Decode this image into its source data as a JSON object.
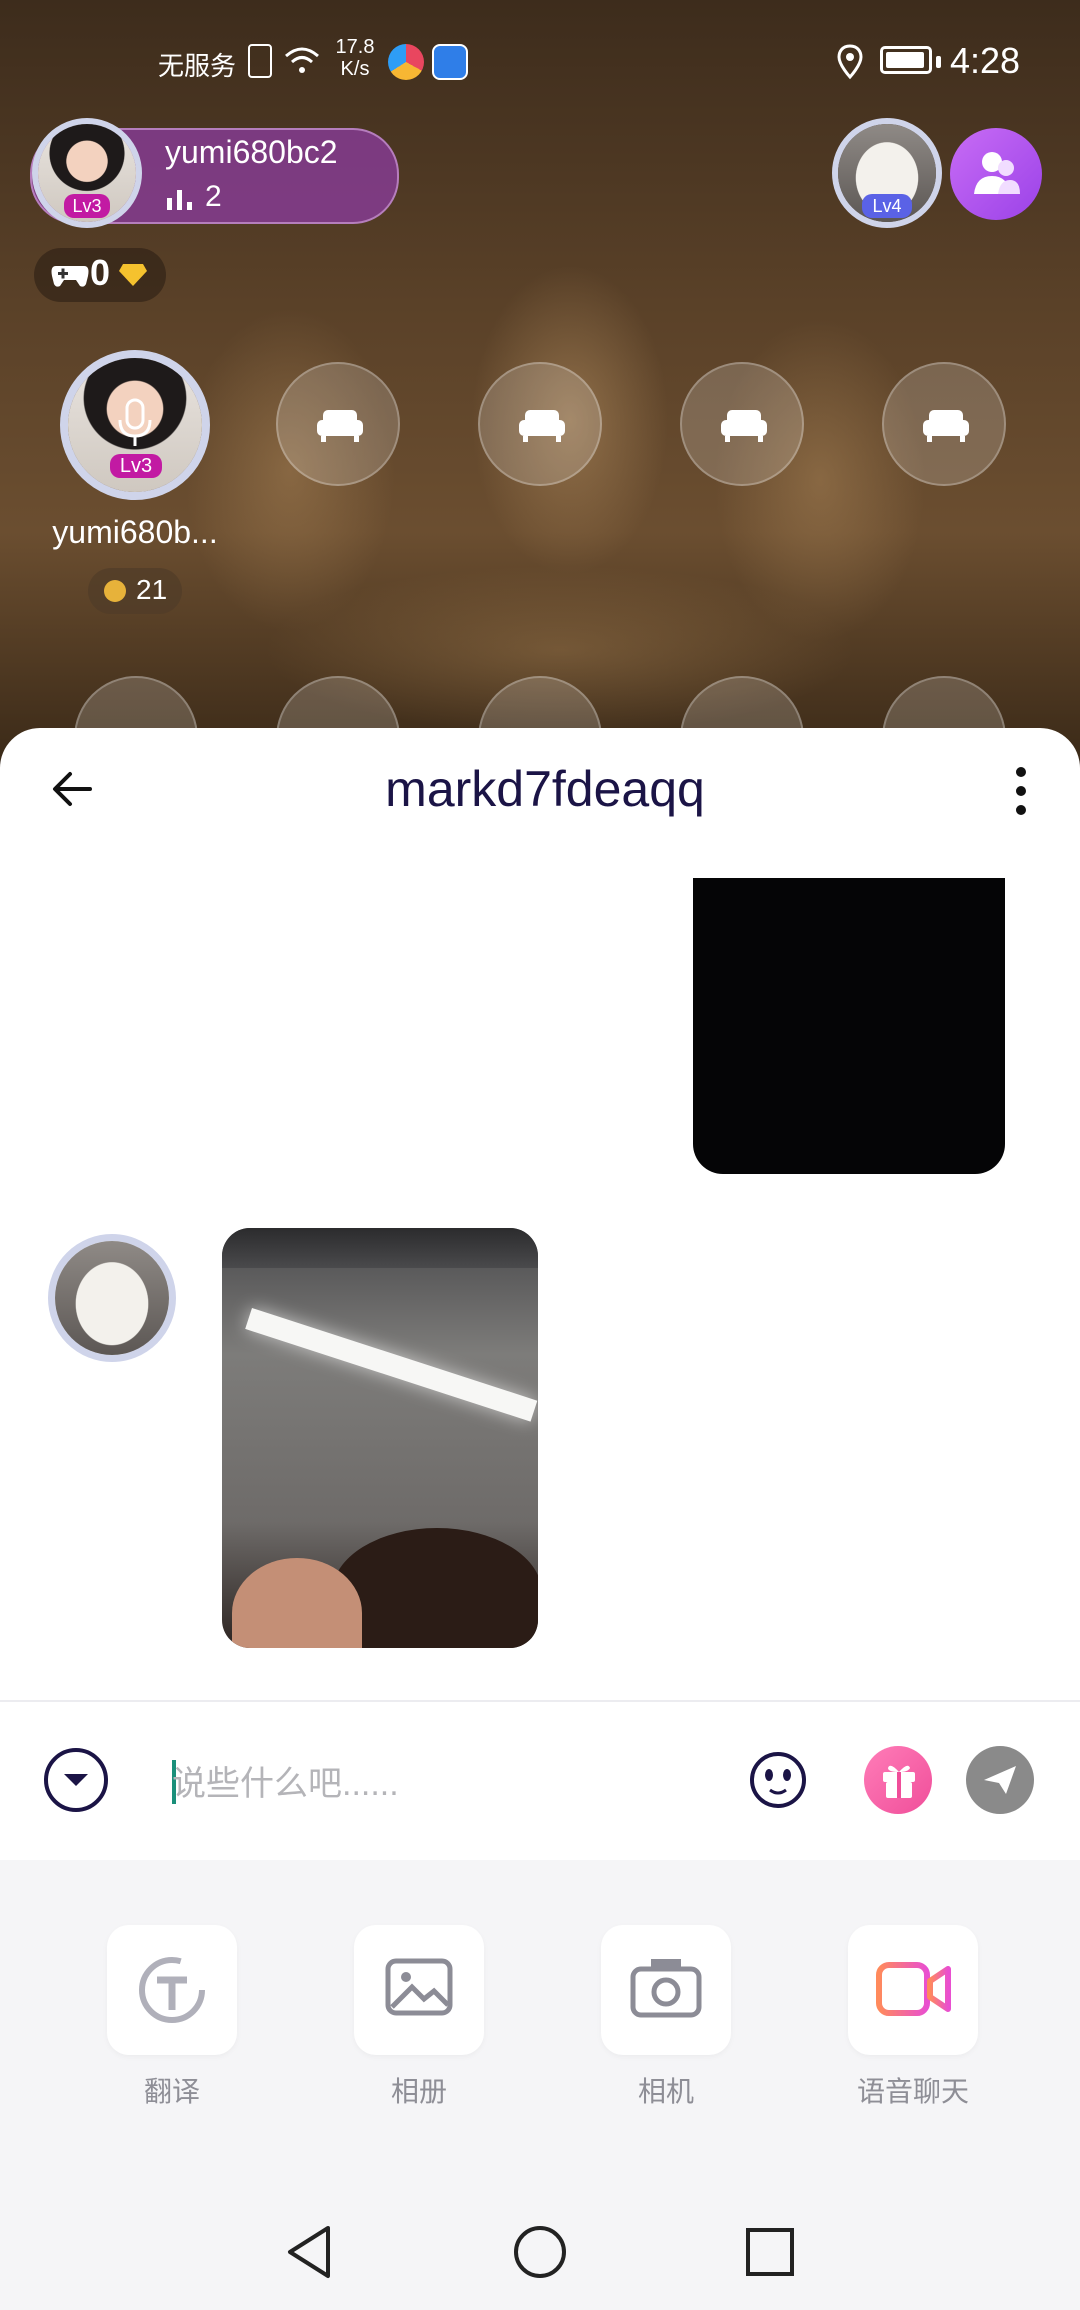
{
  "status_bar": {
    "carrier": "无服务",
    "net_speed_value": "17.8",
    "net_speed_unit": "K/s",
    "time": "4:28"
  },
  "room": {
    "host_name": "yumi680bc2",
    "host_level": "Lv3",
    "online_count": "2",
    "coin_count": "0",
    "right_user_level": "Lv4",
    "seat_user_name": "yumi680b...",
    "seat_user_level": "Lv3",
    "seat_user_score": "21"
  },
  "chat": {
    "title": "markd7fdeaqq",
    "input_placeholder": "说些什么吧......",
    "colors": {
      "title": "#1b1446",
      "gift": "#f06aa6",
      "send": "#8a8a8a",
      "accent_purple": "#a855f7"
    }
  },
  "tools": [
    {
      "label": "翻译",
      "icon": "translate-icon"
    },
    {
      "label": "相册",
      "icon": "album-icon"
    },
    {
      "label": "相机",
      "icon": "camera-icon"
    },
    {
      "label": "语音聊天",
      "icon": "video-call-icon"
    }
  ]
}
